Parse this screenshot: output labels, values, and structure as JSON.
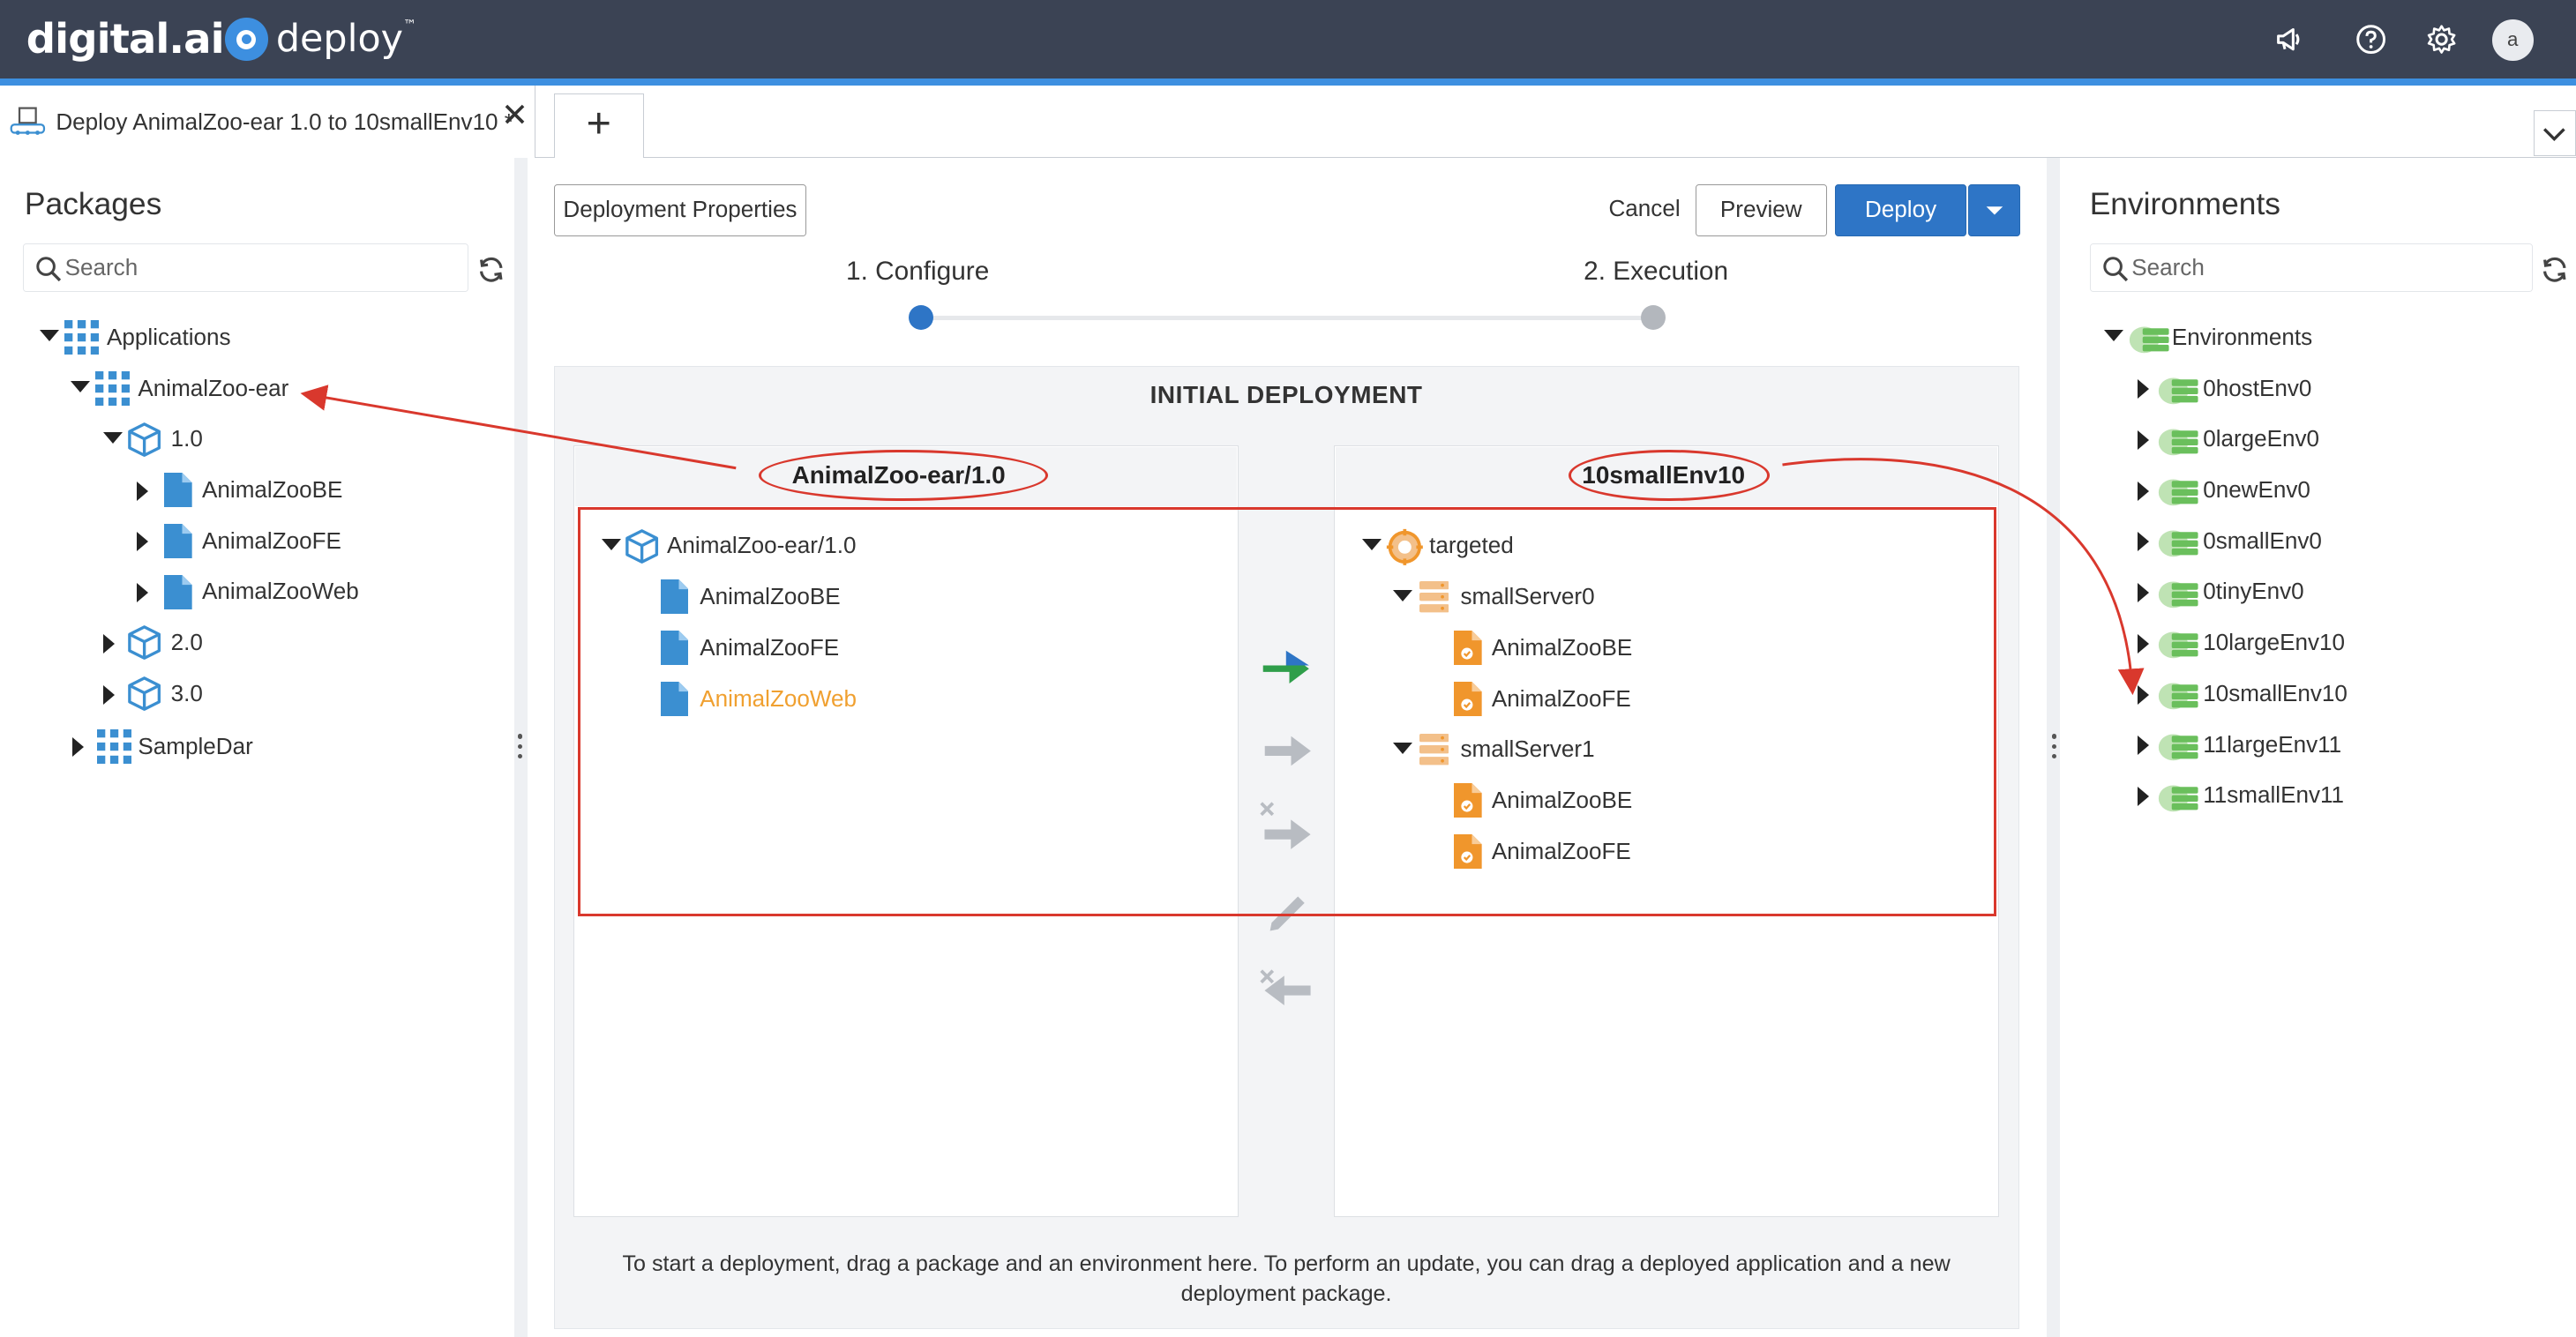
{
  "header": {
    "logo_text": "digital.ai",
    "product_name": "deploy",
    "product_tm": "™",
    "icons": [
      "megaphone-icon",
      "help-icon",
      "gear-icon"
    ],
    "avatar_initial": "a"
  },
  "tabs": {
    "active_title": "Deploy AnimalZoo-ear 1.0 to 10smallEnv10 *",
    "close_glyph": "✕",
    "add_glyph": "+"
  },
  "packages": {
    "title": "Packages",
    "search_placeholder": "Search",
    "tree": {
      "root": "Applications",
      "app": "AnimalZoo-ear",
      "version1": "1.0",
      "children": [
        "AnimalZooBE",
        "AnimalZooFE",
        "AnimalZooWeb"
      ],
      "version2": "2.0",
      "version3": "3.0",
      "app2": "SampleDar"
    }
  },
  "environments": {
    "title": "Environments",
    "search_placeholder": "Search",
    "root": "Environments",
    "items": [
      "0hostEnv0",
      "0largeEnv0",
      "0newEnv0",
      "0smallEnv0",
      "0tinyEnv0",
      "10largeEnv10",
      "10smallEnv10",
      "11largeEnv11",
      "11smallEnv11"
    ]
  },
  "toolbar": {
    "properties_label": "Deployment Properties",
    "cancel_label": "Cancel",
    "preview_label": "Preview",
    "deploy_label": "Deploy"
  },
  "steps": {
    "step1": "1. Configure",
    "step2": "2. Execution"
  },
  "deployment": {
    "header": "INITIAL DEPLOYMENT",
    "package_title": "AnimalZoo-ear/1.0",
    "package_root": "AnimalZoo-ear/1.0",
    "package_items": [
      "AnimalZooBE",
      "AnimalZooFE",
      "AnimalZooWeb"
    ],
    "env_title": "10smallEnv10",
    "env_root": "targeted",
    "server0": "smallServer0",
    "server0_items": [
      "AnimalZooBE",
      "AnimalZooFE"
    ],
    "server1": "smallServer1",
    "server1_items": [
      "AnimalZooBE",
      "AnimalZooFE"
    ],
    "hint": "To start a deployment, drag a package and an environment here. To perform an update, you can drag a deployed application and a new deployment package."
  },
  "colors": {
    "topbar": "#3b4354",
    "accent": "#3d8fe0",
    "primary_button": "#2e75c6",
    "annotation": "#d9382d",
    "package_icon": "#3b8fd1",
    "deployed_icon": "#f0962c",
    "env_icon": "#6abf5c",
    "highlight_text": "#f0a030"
  }
}
